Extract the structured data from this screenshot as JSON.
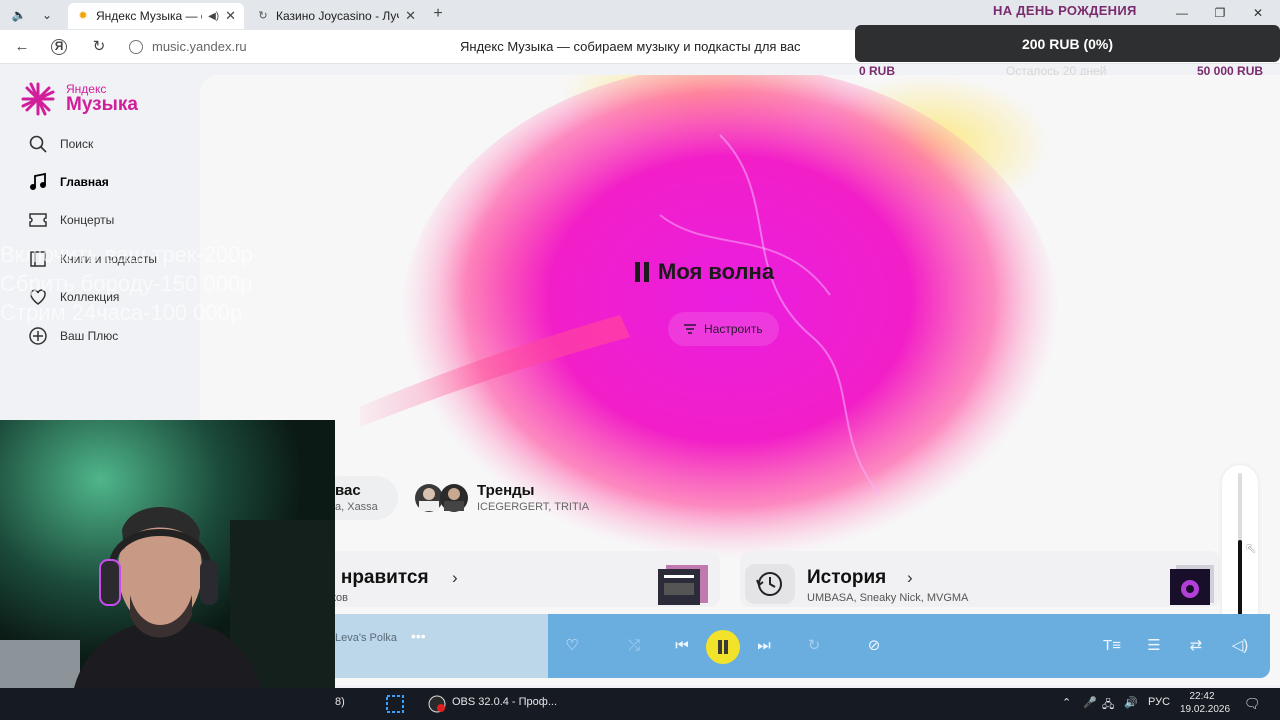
{
  "browser": {
    "tabs": [
      {
        "title": "Яндекс Музыка — со",
        "active": true
      },
      {
        "title": "Казино Joycasino - Лучши",
        "active": false
      }
    ],
    "url": "music.yandex.ru",
    "page_title": "Яндекс Музыка — собираем музыку и подкасты для вас"
  },
  "donation": {
    "title": "НА ДЕНЬ РОЖДЕНИЯ",
    "current": "200 RUB (0%)",
    "min": "0 RUB",
    "remaining": "Осталось 20 дней",
    "goal": "50 000 RUB"
  },
  "logo": {
    "small": "Яндекс",
    "big": "Музыка",
    "color": "#d11f9c"
  },
  "sidebar": {
    "items": [
      {
        "label": "Поиск",
        "icon": "search-icon"
      },
      {
        "label": "Главная",
        "icon": "music-note-icon",
        "active": true
      },
      {
        "label": "Концерты",
        "icon": "ticket-icon"
      },
      {
        "label": "Книги и подкасты",
        "icon": "book-icon"
      },
      {
        "label": "Коллекция",
        "icon": "heart-icon"
      },
      {
        "label": "Ваш Плюс",
        "icon": "plus-icon"
      }
    ]
  },
  "wave": {
    "title": "Моя волна",
    "tune_label": "Настроить"
  },
  "chips": [
    {
      "title": "вас",
      "subtitle": "a, Xassa"
    },
    {
      "title": "Тренды",
      "subtitle": "ICEGERGERT, TRITIA"
    }
  ],
  "cards": [
    {
      "title": "е нравится",
      "subtitle": "еков"
    },
    {
      "title": "История",
      "subtitle": "UMBASA, Sneaky Nick, MVGMA"
    }
  ],
  "player": {
    "track": "Leva's Polka",
    "volume": 0.55,
    "accent": "#f2e22a"
  },
  "overlay": {
    "lines": [
      "Включить ваш трек-200р",
      "Сбрить бороду-150 000р",
      "Стрим 24часа-100 000р"
    ]
  },
  "taskbar": {
    "items": [
      {
        "label": "8)"
      },
      {
        "label": "OBS 32.0.4 - Проф..."
      }
    ],
    "lang": "РУС",
    "time": "22:42",
    "date": "19.02.2026"
  }
}
